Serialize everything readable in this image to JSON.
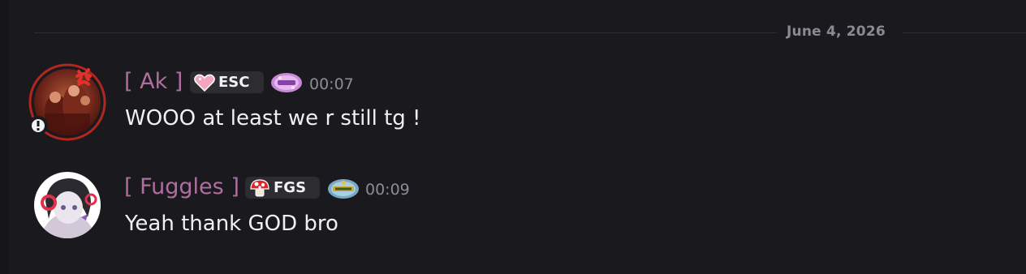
{
  "divider": {
    "date": "June 4, 2026"
  },
  "messages": [
    {
      "author": "[ Ak ]",
      "tag": "ESC",
      "tag_icon": "pink-heart-icon",
      "badge_icon": "purple-badge-icon",
      "time": "00:07",
      "text": "WOOO at least we r still tg !",
      "status_icon": "alert-status-icon"
    },
    {
      "author": "[ Fuggles ]",
      "tag": "FGS",
      "tag_icon": "red-mushroom-icon",
      "badge_icon": "blue-gold-badge-icon",
      "time": "00:09",
      "text": "Yeah thank GOD bro"
    }
  ],
  "colors": {
    "background": "#1a1a1e",
    "username": "#b06e9f",
    "message_text": "#f0f0f2",
    "timestamp": "#8c8c94",
    "tag_bg": "#2c2c31"
  }
}
